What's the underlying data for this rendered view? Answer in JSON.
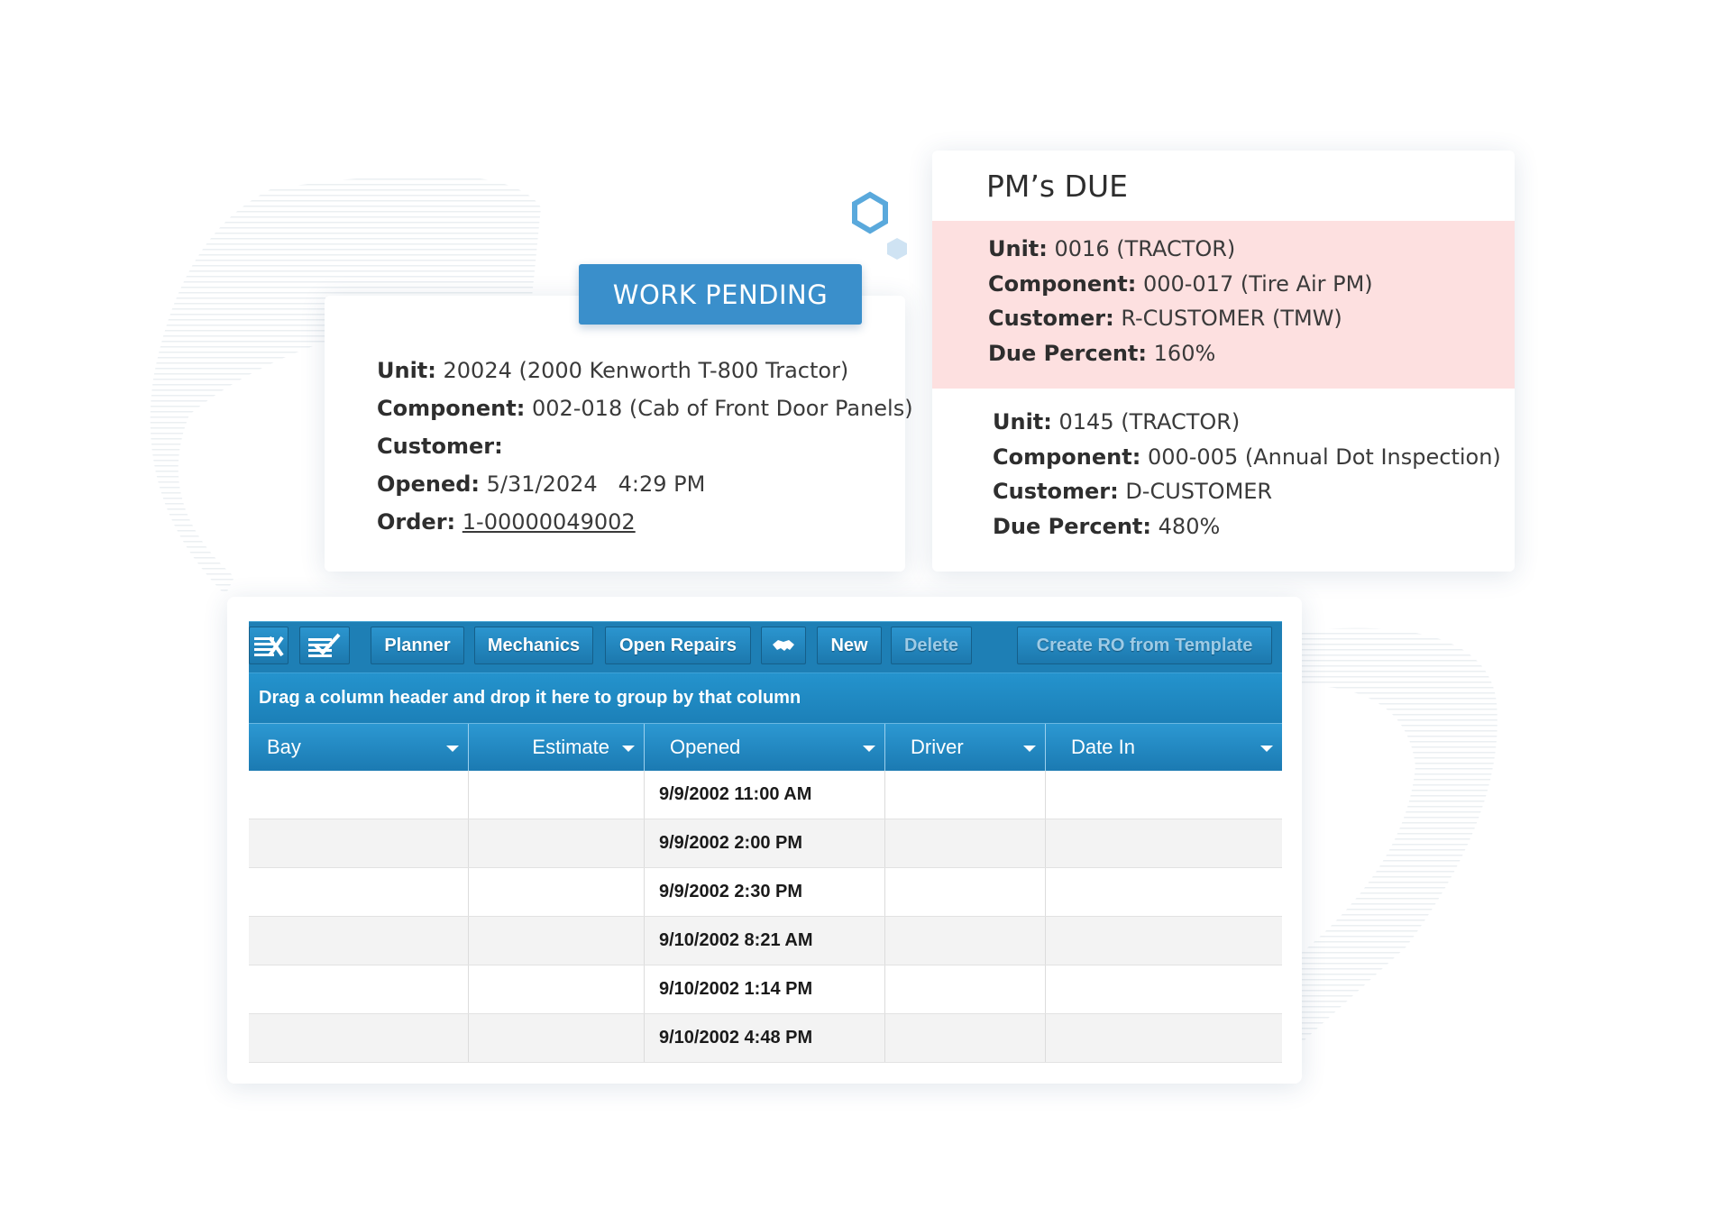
{
  "work_pending": {
    "badge": "WORK PENDING",
    "fields": [
      {
        "label": "Unit:",
        "value": "20024 (2000 Kenworth T-800 Tractor)"
      },
      {
        "label": "Component:",
        "value": "002-018 (Cab of Front Door Panels)"
      },
      {
        "label": "Customer:",
        "value": ""
      },
      {
        "label": "Opened:",
        "value": "5/31/2024   4:29 PM"
      },
      {
        "label": "Order:",
        "value": "1-00000049002"
      }
    ]
  },
  "pms_due": {
    "title": "PM’s DUE",
    "items": [
      {
        "unit_label": "Unit:",
        "unit": "0016 (TRACTOR)",
        "component_label": "Component:",
        "component": "000-017 (Tire Air PM)",
        "customer_label": "Customer:",
        "customer": "R-CUSTOMER (TMW)",
        "due_label": "Due Percent:",
        "due": "160%"
      },
      {
        "unit_label": "Unit:",
        "unit": "0145 (TRACTOR)",
        "component_label": "Component:",
        "component": "000-005 (Annual Dot Inspection)",
        "customer_label": "Customer:",
        "customer": "D-CUSTOMER",
        "due_label": "Due Percent:",
        "due": "480%"
      }
    ]
  },
  "grid": {
    "toolbar": {
      "planner": "Planner",
      "mechanics": "Mechanics",
      "open_repairs": "Open Repairs",
      "new": "New",
      "delete": "Delete",
      "create_ro": "Create RO from Template"
    },
    "group_hint": "Drag a column header and drop it here to group by that column",
    "columns": [
      "Bay",
      "Estimate",
      "Opened",
      "Driver",
      "Date In"
    ],
    "rows": [
      {
        "bay": "",
        "estimate": "",
        "opened": "9/9/2002 11:00 AM",
        "driver": "",
        "date_in": ""
      },
      {
        "bay": "",
        "estimate": "",
        "opened": "9/9/2002 2:00 PM",
        "driver": "",
        "date_in": ""
      },
      {
        "bay": "",
        "estimate": "",
        "opened": "9/9/2002 2:30 PM",
        "driver": "",
        "date_in": ""
      },
      {
        "bay": "",
        "estimate": "",
        "opened": "9/10/2002 8:21 AM",
        "driver": "",
        "date_in": ""
      },
      {
        "bay": "",
        "estimate": "",
        "opened": "9/10/2002 1:14 PM",
        "driver": "",
        "date_in": ""
      },
      {
        "bay": "",
        "estimate": "",
        "opened": "9/10/2002 4:48 PM",
        "driver": "",
        "date_in": ""
      }
    ]
  },
  "colors": {
    "accent": "#3a8fcb",
    "toolbar": "#1e7fb5",
    "pm_highlight": "#fde0e0",
    "hexagon": "#5aa9dc"
  }
}
